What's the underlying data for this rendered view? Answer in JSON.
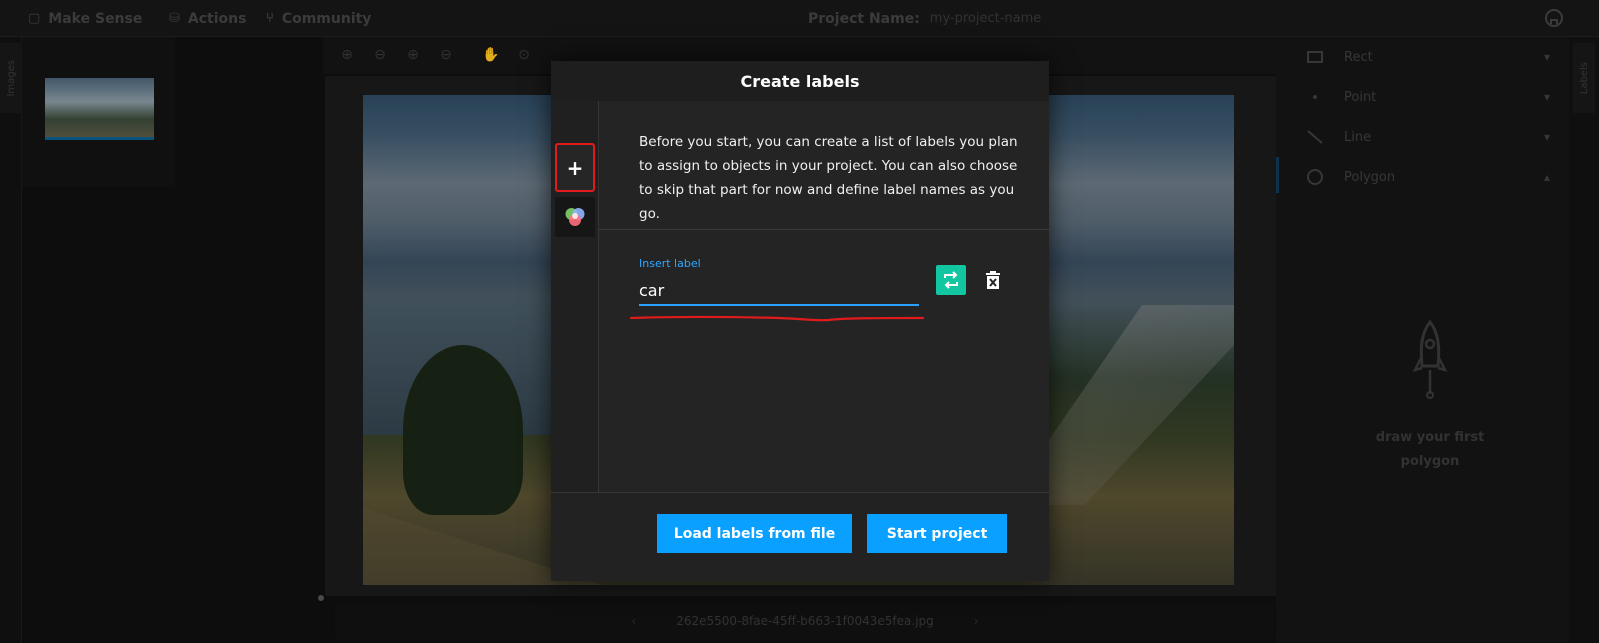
{
  "topbar": {
    "brand": "Make Sense",
    "actions": "Actions",
    "community": "Community",
    "project_name_label": "Project Name:",
    "project_name_value": "my-project-name"
  },
  "left_panel": {
    "tab_label": "Images"
  },
  "right_panel": {
    "tab_label": "Labels",
    "tools": [
      {
        "label": "Rect",
        "icon": "rect-icon",
        "expanded": false
      },
      {
        "label": "Point",
        "icon": "point-icon",
        "expanded": false
      },
      {
        "label": "Line",
        "icon": "line-icon",
        "expanded": false
      },
      {
        "label": "Polygon",
        "icon": "polygon-icon",
        "expanded": true
      }
    ],
    "empty_state": {
      "line1": "draw your first",
      "line2": "polygon"
    }
  },
  "editor": {
    "filename": "262e5500-8fae-45ff-b663-1f0043e5fea.jpg"
  },
  "modal": {
    "title": "Create labels",
    "intro": "Before you start, you can create a list of labels you plan to assign to objects in your project. You can also choose to skip that part for now and define label names as you go.",
    "add_button": "+",
    "label_field": {
      "label": "Insert label",
      "value": "car"
    },
    "load_button": "Load labels from file",
    "start_button": "Start project"
  },
  "colors": {
    "accent": "#0aa0ff",
    "swap_green": "#11c6a1",
    "highlight_red": "#e11b1b"
  }
}
